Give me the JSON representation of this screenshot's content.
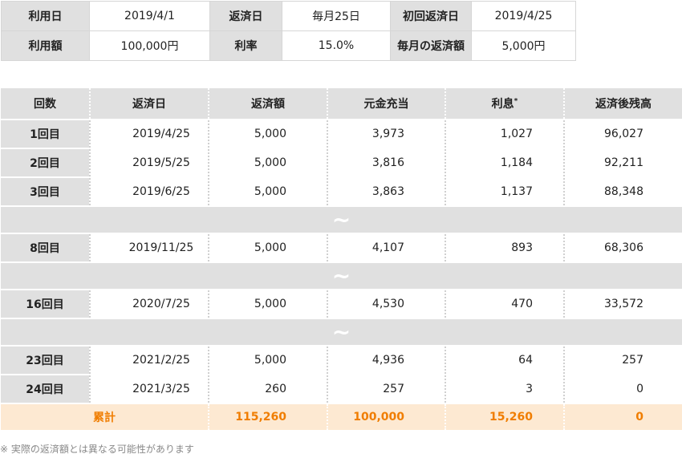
{
  "summary": {
    "row1": [
      {
        "label": "利用日",
        "value": "2019/4/1"
      },
      {
        "label": "返済日",
        "value": "毎月25日"
      },
      {
        "label": "初回返済日",
        "value": "2019/4/25"
      }
    ],
    "row2": [
      {
        "label": "利用額",
        "value": "100,000円"
      },
      {
        "label": "利率",
        "value": "15.0%"
      },
      {
        "label": "毎月の返済額",
        "value": "5,000円"
      }
    ]
  },
  "schedule": {
    "headers": [
      "回数",
      "返済日",
      "返済額",
      "元金充当",
      "利息",
      "返済後残高"
    ],
    "interest_mark": "*",
    "gap_symbol": "~",
    "rows": [
      {
        "count": "1回目",
        "date": "2019/4/25",
        "payment": "5,000",
        "principal": "3,973",
        "interest": "1,027",
        "balance": "96,027"
      },
      {
        "count": "2回目",
        "date": "2019/5/25",
        "payment": "5,000",
        "principal": "3,816",
        "interest": "1,184",
        "balance": "92,211"
      },
      {
        "count": "3回目",
        "date": "2019/6/25",
        "payment": "5,000",
        "principal": "3,863",
        "interest": "1,137",
        "balance": "88,348"
      },
      {
        "count": "8回目",
        "date": "2019/11/25",
        "payment": "5,000",
        "principal": "4,107",
        "interest": "893",
        "balance": "68,306"
      },
      {
        "count": "16回目",
        "date": "2020/7/25",
        "payment": "5,000",
        "principal": "4,530",
        "interest": "470",
        "balance": "33,572"
      },
      {
        "count": "23回目",
        "date": "2021/2/25",
        "payment": "5,000",
        "principal": "4,936",
        "interest": "64",
        "balance": "257"
      },
      {
        "count": "24回目",
        "date": "2021/3/25",
        "payment": "260",
        "principal": "257",
        "interest": "3",
        "balance": "0"
      }
    ],
    "total": {
      "label": "累計",
      "payment": "115,260",
      "principal": "100,000",
      "interest": "15,260",
      "balance": "0"
    }
  },
  "note": "※ 実際の返済額とは異なる可能性があります",
  "colors": {
    "header_bg": "#e0e0e0",
    "total_bg": "#fde9d2",
    "total_text": "#f07d00"
  }
}
